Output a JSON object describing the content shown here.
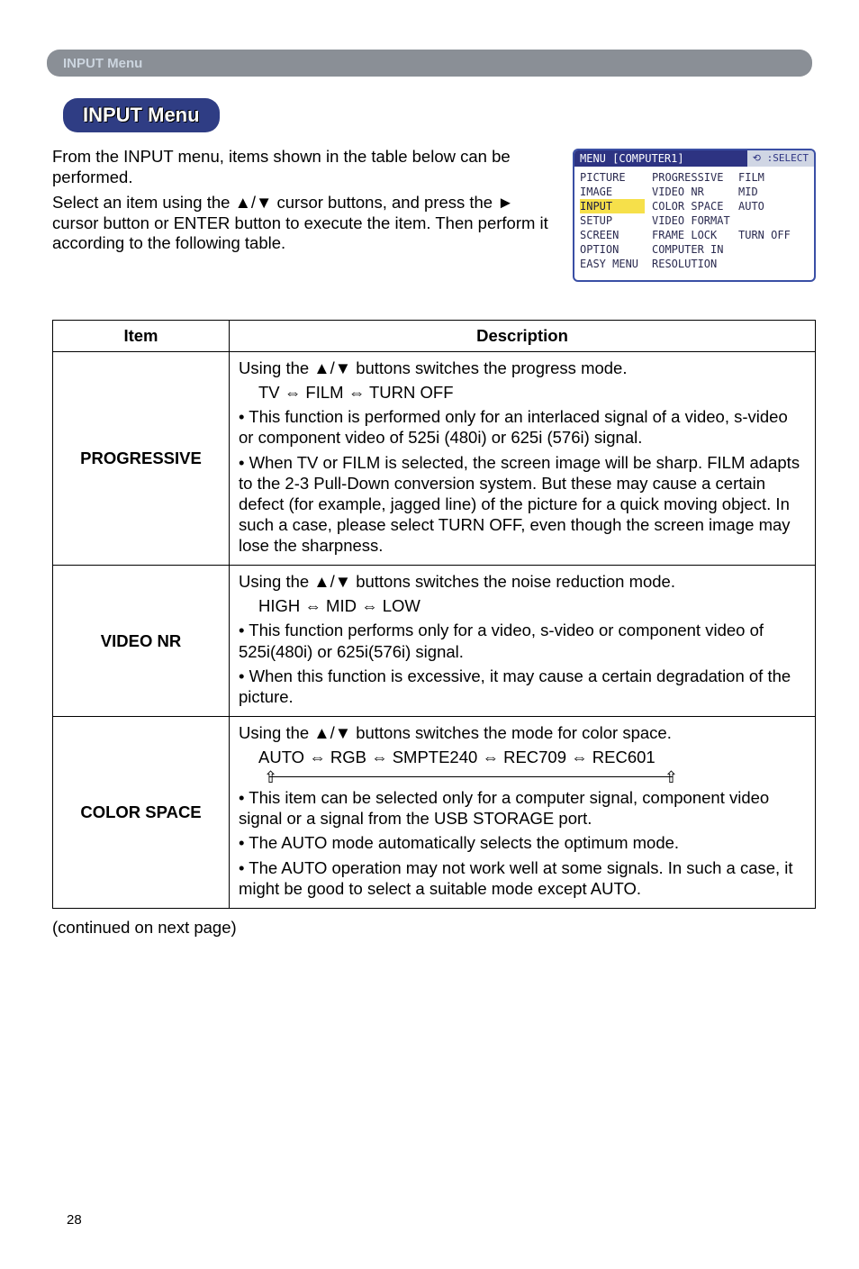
{
  "header_tab": "INPUT Menu",
  "pill_title": "INPUT Menu",
  "intro": {
    "p1": "From the INPUT menu, items shown in the table below can be performed.",
    "p2": "Select an item using the ▲/▼ cursor buttons, and press the ► cursor button or ENTER button to execute the item. Then perform it according to the following table."
  },
  "osd": {
    "header_left": "MENU [COMPUTER1]",
    "header_right": "⟲ :SELECT",
    "left_items": [
      "PICTURE",
      "IMAGE",
      "INPUT",
      "SETUP",
      "SCREEN",
      "OPTION",
      "EASY MENU"
    ],
    "selected": "INPUT",
    "right_rows": [
      {
        "k": "PROGRESSIVE",
        "v": "FILM"
      },
      {
        "k": "VIDEO NR",
        "v": "MID"
      },
      {
        "k": "COLOR SPACE",
        "v": "AUTO"
      },
      {
        "k": "VIDEO FORMAT",
        "v": ""
      },
      {
        "k": "FRAME LOCK",
        "v": "TURN OFF"
      },
      {
        "k": "COMPUTER IN",
        "v": ""
      },
      {
        "k": "RESOLUTION",
        "v": ""
      }
    ]
  },
  "table": {
    "head_item": "Item",
    "head_desc": "Description",
    "rows": [
      {
        "item": "PROGRESSIVE",
        "d1": "Using the ▲/▼ buttons switches the progress mode.",
        "d1b": "TV ⇔ FILM ⇔ TURN OFF",
        "d2": "• This function is performed only for an interlaced signal of a video, s-video or component video of 525i (480i) or 625i (576i) signal.",
        "d3": "• When TV or FILM is selected, the screen image will be sharp. FILM adapts to the 2-3 Pull-Down conversion system. But these may cause a certain defect (for example, jagged line) of the picture for a quick moving object. In such a case, please select TURN OFF, even though the screen image may lose the sharpness."
      },
      {
        "item": "VIDEO NR",
        "d1": "Using the ▲/▼ buttons switches the noise reduction mode.",
        "d1b": "HIGH ⇔ MID ⇔ LOW",
        "d2": "• This function performs only for a video, s-video or component video of 525i(480i) or 625i(576i) signal.",
        "d3": "• When this function is excessive, it may cause a certain degradation of the picture."
      },
      {
        "item": "COLOR SPACE",
        "d1": "Using the ▲/▼ buttons switches the mode for color space.",
        "d1b": "AUTO ⇔ RGB ⇔ SMPTE240 ⇔ REC709 ⇔ REC601",
        "d2": "• This item can be selected only for a computer signal, component video signal or a signal from the USB STORAGE port.",
        "d3": "• The AUTO mode automatically selects the optimum mode.",
        "d4": "• The AUTO operation may not work well at some signals. In such a case, it might be good to select a suitable mode except AUTO."
      }
    ]
  },
  "continued": "(continued on next page)",
  "page_number": "28"
}
